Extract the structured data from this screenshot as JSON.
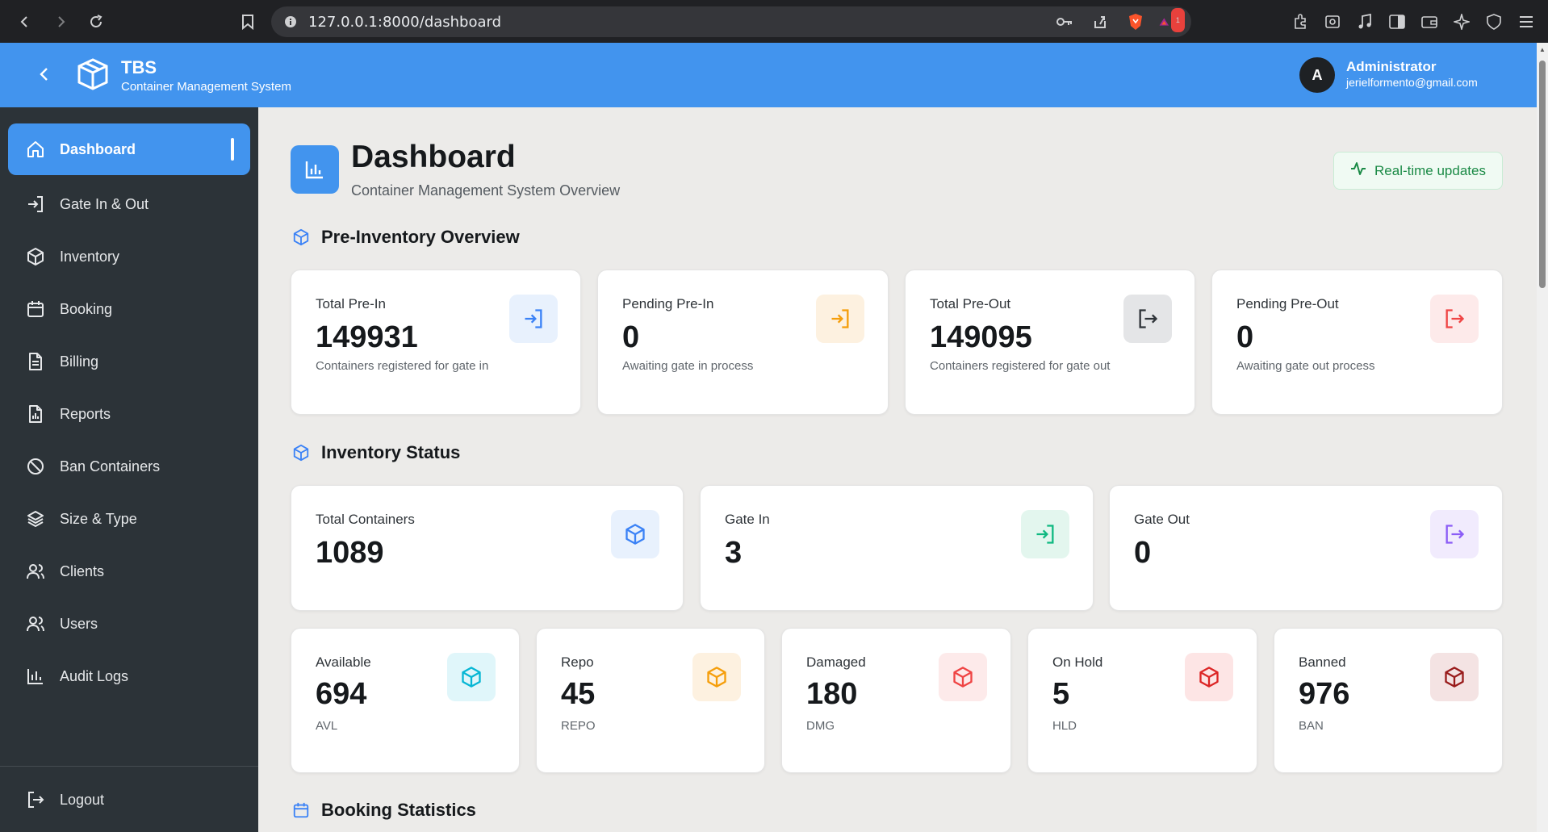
{
  "browser": {
    "url": "127.0.0.1:8000/dashboard",
    "notification_count": "1"
  },
  "header": {
    "brand": "TBS",
    "brand_sub": "Container Management System",
    "avatar_initial": "A",
    "user_name": "Administrator",
    "user_email": "jerielformento@gmail.com"
  },
  "sidebar": {
    "items": [
      {
        "label": "Dashboard",
        "icon": "home-icon"
      },
      {
        "label": "Gate In & Out",
        "icon": "login-icon"
      },
      {
        "label": "Inventory",
        "icon": "box-icon"
      },
      {
        "label": "Booking",
        "icon": "calendar-icon"
      },
      {
        "label": "Billing",
        "icon": "document-icon"
      },
      {
        "label": "Reports",
        "icon": "report-icon"
      },
      {
        "label": "Ban Containers",
        "icon": "ban-icon"
      },
      {
        "label": "Size & Type",
        "icon": "layers-icon"
      },
      {
        "label": "Clients",
        "icon": "users-icon"
      },
      {
        "label": "Users",
        "icon": "users-icon"
      },
      {
        "label": "Audit Logs",
        "icon": "bar-chart-icon"
      }
    ],
    "logout": "Logout"
  },
  "page": {
    "title": "Dashboard",
    "subtitle": "Container Management System Overview",
    "realtime_label": "Real-time updates"
  },
  "pre_inventory": {
    "title": "Pre-Inventory Overview",
    "cards": [
      {
        "label": "Total Pre-In",
        "value": "149931",
        "desc": "Containers registered for gate in",
        "color": "#3b82f6",
        "bg": "#e8f1fd"
      },
      {
        "label": "Pending Pre-In",
        "value": "0",
        "desc": "Awaiting gate in process",
        "color": "#f59e0b",
        "bg": "#fdf1e0"
      },
      {
        "label": "Total Pre-Out",
        "value": "149095",
        "desc": "Containers registered for gate out",
        "color": "#2f3439",
        "bg": "#e4e5e7"
      },
      {
        "label": "Pending Pre-Out",
        "value": "0",
        "desc": "Awaiting gate out process",
        "color": "#ef4444",
        "bg": "#fdeaea"
      }
    ]
  },
  "inventory_status": {
    "title": "Inventory Status",
    "top_cards": [
      {
        "label": "Total Containers",
        "value": "1089",
        "color": "#3b82f6",
        "bg": "#e8f1fd"
      },
      {
        "label": "Gate In",
        "value": "3",
        "color": "#10b981",
        "bg": "#e3f6ee"
      },
      {
        "label": "Gate Out",
        "value": "0",
        "color": "#8b5cf6",
        "bg": "#f1ebfd"
      }
    ],
    "status_cards": [
      {
        "label": "Available",
        "value": "694",
        "code": "AVL",
        "color": "#06b6d4",
        "bg": "#e0f6fa"
      },
      {
        "label": "Repo",
        "value": "45",
        "code": "REPO",
        "color": "#f59e0b",
        "bg": "#fdf1e0"
      },
      {
        "label": "Damaged",
        "value": "180",
        "code": "DMG",
        "color": "#ef4444",
        "bg": "#fdeaea"
      },
      {
        "label": "On Hold",
        "value": "5",
        "code": "HLD",
        "color": "#dc2626",
        "bg": "#fde5e5"
      },
      {
        "label": "Banned",
        "value": "976",
        "code": "BAN",
        "color": "#991b1b",
        "bg": "#f4e3e3"
      }
    ]
  },
  "booking": {
    "title": "Booking Statistics"
  }
}
